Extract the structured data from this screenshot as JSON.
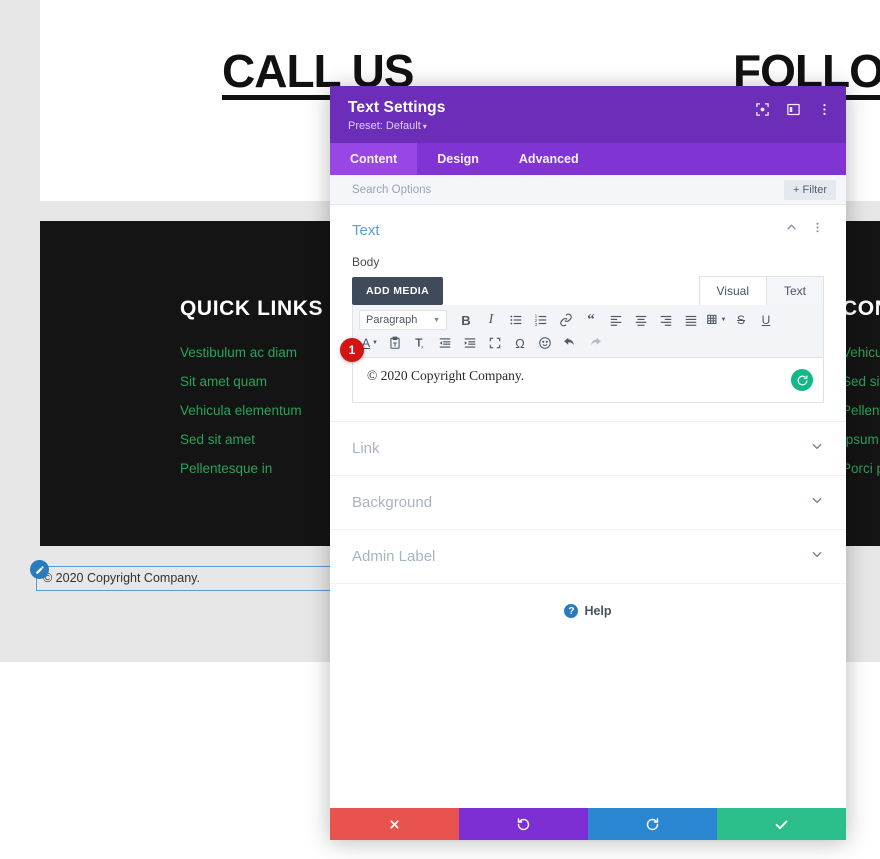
{
  "underlying_page": {
    "headings": [
      {
        "text": "CALL US"
      },
      {
        "text": "FOLLOW"
      }
    ],
    "footer_columns": [
      {
        "title": "QUICK LINKS",
        "links": [
          "Vestibulum ac diam",
          "Sit amet quam",
          "Vehicula elementum",
          "Sed sit amet",
          "Pellentesque in"
        ]
      },
      {
        "title": "CONTACT",
        "links": [
          "Vehicula",
          "Sed sit a",
          "Pellente",
          "Ipsum id",
          "Porci po"
        ]
      }
    ],
    "copyright_module": {
      "text": "© 2020 Copyright Company.",
      "edit_icon": "pencil-icon"
    }
  },
  "modal": {
    "title": "Text Settings",
    "preset_label": "Preset: Default",
    "header_icons": [
      {
        "name": "fullscreen-icon"
      },
      {
        "name": "layout-toggle-icon"
      },
      {
        "name": "more-options-icon"
      }
    ],
    "tabs": [
      {
        "label": "Content",
        "active": true
      },
      {
        "label": "Design",
        "active": false
      },
      {
        "label": "Advanced",
        "active": false
      }
    ],
    "search": {
      "placeholder": "Search Options"
    },
    "filter_button": {
      "label": "Filter",
      "icon": "plus-icon"
    },
    "sections": {
      "text": {
        "title": "Text",
        "collapse_icon": "chevron-up-icon",
        "more_icon": "more-options-icon",
        "field_label": "Body",
        "add_media_label": "ADD MEDIA",
        "editor_tabs": [
          {
            "label": "Visual",
            "active": true
          },
          {
            "label": "Text",
            "active": false
          }
        ],
        "format_select": {
          "value": "Paragraph",
          "caret": "chevron-down-icon"
        },
        "toolbar_row1": [
          {
            "name": "bold-icon",
            "glyph": "B"
          },
          {
            "name": "italic-icon",
            "glyph": "I"
          },
          {
            "name": "bullet-list-icon",
            "glyph": ""
          },
          {
            "name": "numbered-list-icon",
            "glyph": ""
          },
          {
            "name": "link-icon",
            "glyph": ""
          },
          {
            "name": "blockquote-icon",
            "glyph": "“"
          },
          {
            "name": "align-left-icon",
            "glyph": ""
          },
          {
            "name": "align-center-icon",
            "glyph": ""
          },
          {
            "name": "align-right-icon",
            "glyph": ""
          },
          {
            "name": "align-justify-icon",
            "glyph": ""
          },
          {
            "name": "table-icon",
            "glyph": ""
          },
          {
            "name": "strikethrough-icon",
            "glyph": "S"
          },
          {
            "name": "underline-icon",
            "glyph": "U"
          }
        ],
        "toolbar_row2": [
          {
            "name": "text-color-icon",
            "glyph": "A"
          },
          {
            "name": "paste-as-text-icon",
            "glyph": ""
          },
          {
            "name": "clear-formatting-icon",
            "glyph": "T"
          },
          {
            "name": "outdent-icon",
            "glyph": ""
          },
          {
            "name": "indent-icon",
            "glyph": ""
          },
          {
            "name": "fullscreen-editor-icon",
            "glyph": ""
          },
          {
            "name": "special-character-icon",
            "glyph": "Ω"
          },
          {
            "name": "emoji-icon",
            "glyph": ""
          },
          {
            "name": "undo-icon",
            "glyph": ""
          },
          {
            "name": "redo-icon",
            "glyph": ""
          }
        ],
        "content": "© 2020 Copyright Company.",
        "revert_icon": "revert-icon"
      },
      "collapsed": [
        {
          "title": "Link",
          "icon": "chevron-down-icon"
        },
        {
          "title": "Background",
          "icon": "chevron-down-icon"
        },
        {
          "title": "Admin Label",
          "icon": "chevron-down-icon"
        }
      ]
    },
    "help": {
      "label": "Help",
      "icon": "question-icon"
    },
    "footer_buttons": [
      {
        "name": "cancel-button",
        "icon": "close-icon",
        "color": "#e8544d"
      },
      {
        "name": "undo-button",
        "icon": "undo-icon",
        "color": "#7e2fd4"
      },
      {
        "name": "redo-button",
        "icon": "redo-icon",
        "color": "#2a86d0"
      },
      {
        "name": "save-button",
        "icon": "check-icon",
        "color": "#2bbd8a"
      }
    ]
  },
  "annotation_badge": {
    "number": "1",
    "color": "#d31414"
  }
}
